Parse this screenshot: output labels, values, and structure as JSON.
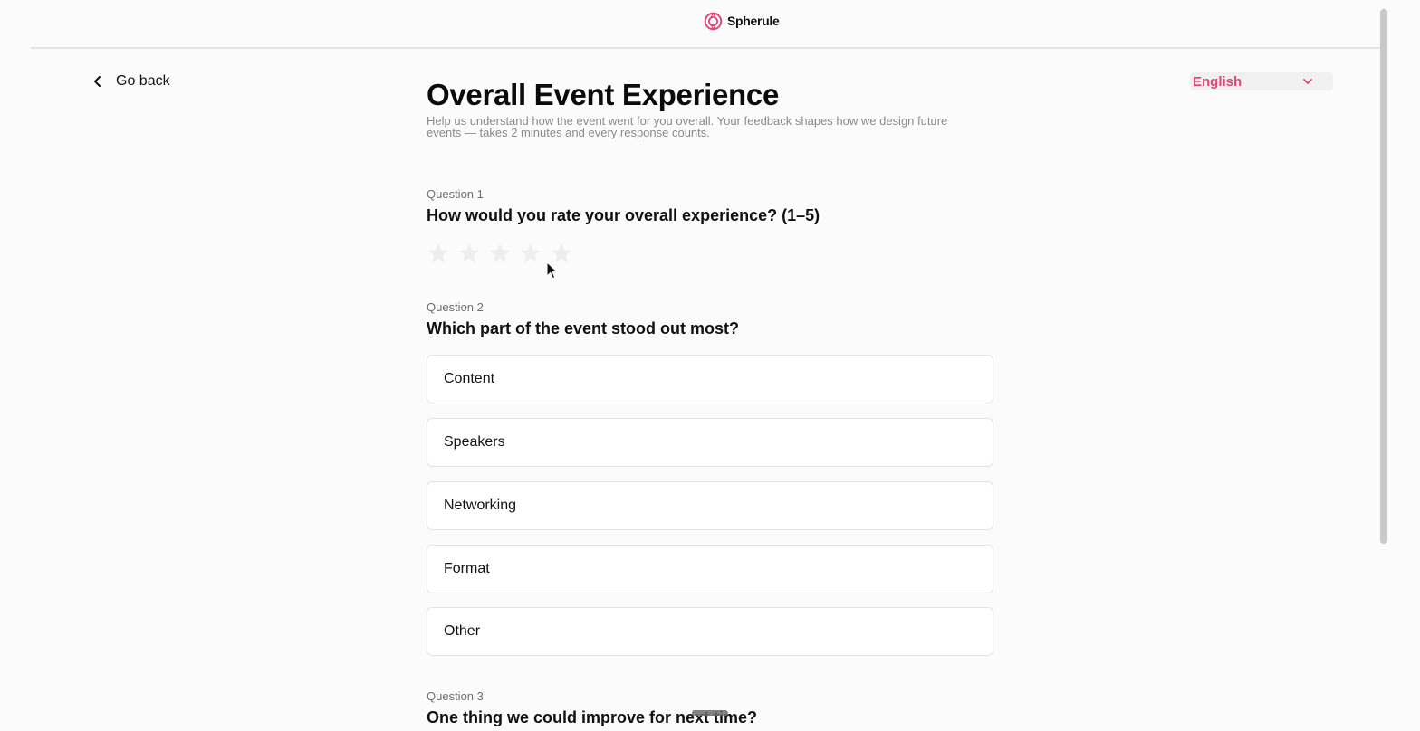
{
  "header": {
    "brand_name": "Spherule",
    "brand_color": "#e0447a"
  },
  "nav": {
    "go_back_label": "Go back",
    "back_icon": "chevron-left-icon"
  },
  "language": {
    "selected": "English",
    "dropdown_icon": "chevron-down-icon"
  },
  "page": {
    "title": "Overall Event Experience",
    "subtitle": "Help us understand how the event went for you overall. Your feedback shapes how we design future events — takes 2 minutes and every response counts."
  },
  "questions": [
    {
      "number": "Question 1",
      "text": "How would you rate your overall experience? (1–5)",
      "type": "rating",
      "max_rating": 5,
      "rating_value": 0
    },
    {
      "number": "Question 2",
      "text": "Which part of the event stood out most?",
      "type": "single-choice",
      "options": [
        "Content",
        "Speakers",
        "Networking",
        "Format",
        "Other"
      ]
    },
    {
      "number": "Question 3",
      "text": "One thing we could improve for next time?",
      "type": "text"
    }
  ]
}
